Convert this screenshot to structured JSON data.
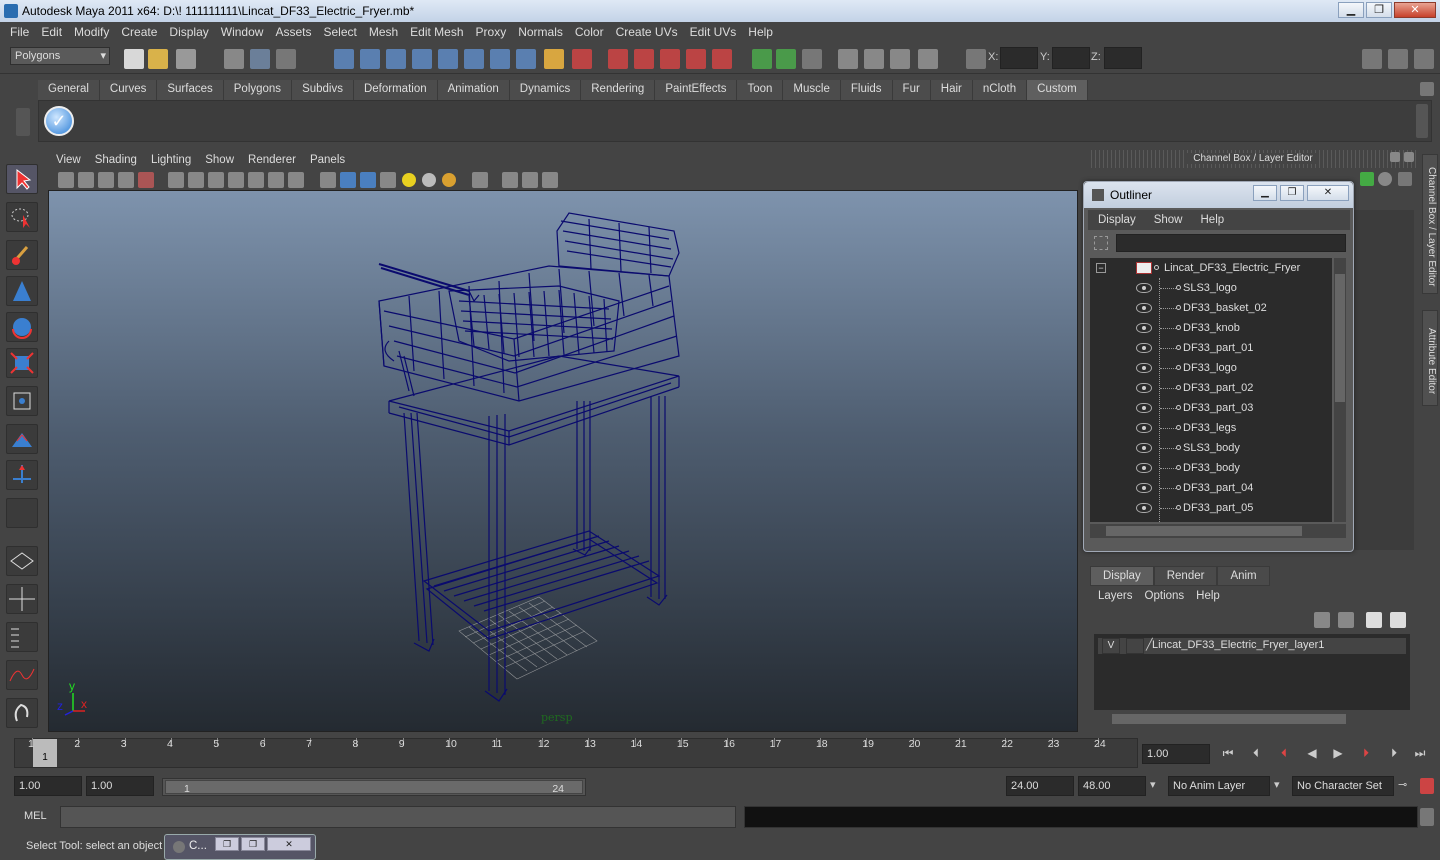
{
  "window": {
    "title": "Autodesk Maya 2011 x64: D:\\! 111111111\\Lincat_DF33_Electric_Fryer.mb*",
    "minimize": "▁",
    "maximize": "❐",
    "close": "✕"
  },
  "menubar": [
    "File",
    "Edit",
    "Modify",
    "Create",
    "Display",
    "Window",
    "Assets",
    "Select",
    "Mesh",
    "Edit Mesh",
    "Proxy",
    "Normals",
    "Color",
    "Create UVs",
    "Edit UVs",
    "Help"
  ],
  "statusline": {
    "mode": "Polygons",
    "x_label": "X:",
    "y_label": "Y:",
    "z_label": "Z:"
  },
  "shelf": {
    "tabs": [
      "General",
      "Curves",
      "Surfaces",
      "Polygons",
      "Subdivs",
      "Deformation",
      "Animation",
      "Dynamics",
      "Rendering",
      "PaintEffects",
      "Toon",
      "Muscle",
      "Fluids",
      "Fur",
      "Hair",
      "nCloth",
      "Custom"
    ],
    "active": "Custom",
    "check_icon": "check-icon"
  },
  "viewport": {
    "menu": [
      "View",
      "Shading",
      "Lighting",
      "Show",
      "Renderer",
      "Panels"
    ],
    "camera_label": "persp",
    "axis_y": "y",
    "axis_x": "x",
    "axis_z": "z",
    "wire_color": "#0a0a6e"
  },
  "right_panel": {
    "header": "Channel Box / Layer Editor",
    "side_tabs": [
      "Channel Box / Layer Editor",
      "Attribute Editor"
    ]
  },
  "outliner": {
    "title": "Outliner",
    "menu": [
      "Display",
      "Show",
      "Help"
    ],
    "root": "Lincat_DF33_Electric_Fryer",
    "items": [
      "SLS3_logo",
      "DF33_basket_02",
      "DF33_knob",
      "DF33_part_01",
      "DF33_logo",
      "DF33_part_02",
      "DF33_part_03",
      "DF33_legs",
      "SLS3_body",
      "DF33_body",
      "DF33_part_04",
      "DF33_part_05"
    ]
  },
  "layer_editor": {
    "tabs": [
      "Display",
      "Render",
      "Anim"
    ],
    "active": "Display",
    "menu": [
      "Layers",
      "Options",
      "Help"
    ],
    "layer": {
      "visible": "V",
      "name": "Lincat_DF33_Electric_Fryer_layer1"
    }
  },
  "timeline": {
    "ticks": [
      "1",
      "2",
      "3",
      "4",
      "5",
      "6",
      "7",
      "8",
      "9",
      "10",
      "11",
      "12",
      "13",
      "14",
      "15",
      "16",
      "17",
      "18",
      "19",
      "20",
      "21",
      "22",
      "23",
      "24"
    ],
    "current": "1",
    "current_time": "1.00"
  },
  "range": {
    "start": "1.00",
    "inner_start": "1.00",
    "range_left": "1",
    "range_right": "24",
    "end": "24.00",
    "outer_end": "48.00",
    "anim_layer": "No Anim Layer",
    "char_set": "No Character Set"
  },
  "cmdline": {
    "label": "MEL"
  },
  "status": {
    "help": "Select Tool: select an object",
    "task_title": "C..."
  }
}
